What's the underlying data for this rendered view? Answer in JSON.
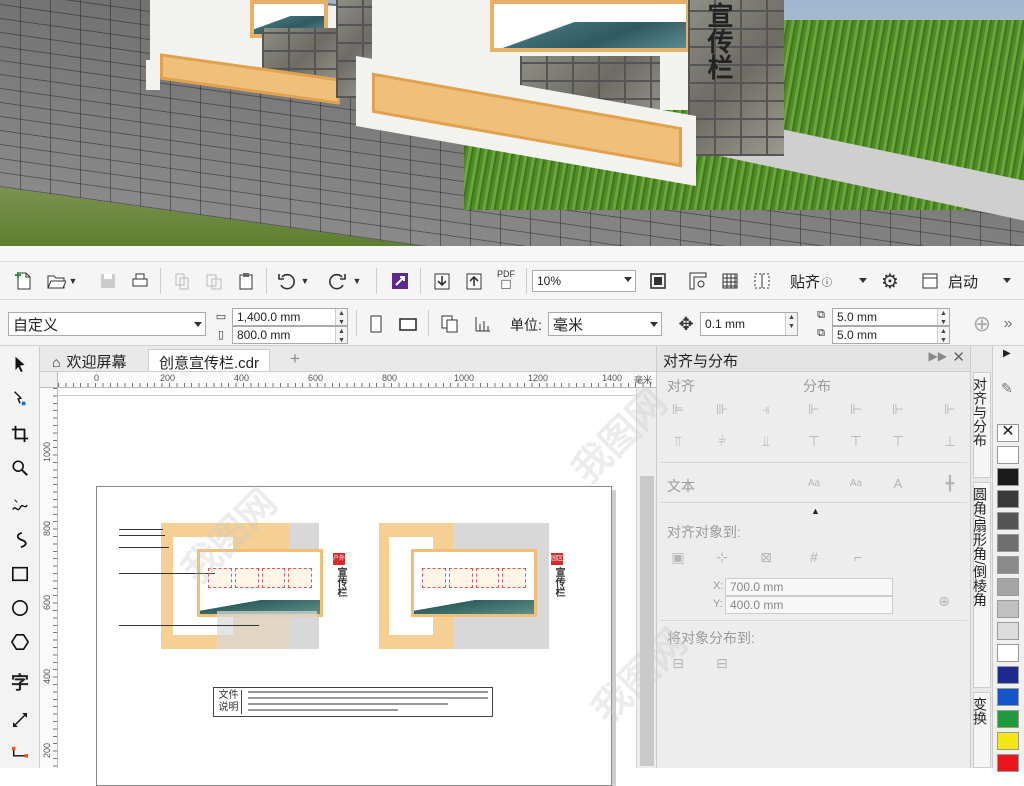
{
  "scene": {
    "board_text": "宣传栏"
  },
  "toolbar1": {
    "zoom_value": "10%",
    "snap_label": "贴齐",
    "launch_label": "启动",
    "pdf_label": "PDF"
  },
  "toolbar2": {
    "preset_value": "自定义",
    "width_value": "1,400.0 mm",
    "height_value": "800.0 mm",
    "unit_label": "单位:",
    "unit_value": "毫米",
    "nudge_value": "0.1 mm",
    "dup_x_value": "5.0 mm",
    "dup_y_value": "5.0 mm"
  },
  "tabs": [
    {
      "label": "欢迎屏幕"
    },
    {
      "label": "创意宣传栏.cdr"
    }
  ],
  "ruler": {
    "h_ticks": [
      "0",
      "200",
      "400",
      "600",
      "800",
      "1000",
      "1200",
      "1400"
    ],
    "h_unit": "毫米",
    "v_ticks": [
      "1000",
      "800",
      "600",
      "400",
      "200"
    ]
  },
  "canvas": {
    "tag1": "户外",
    "tag2": "园区",
    "board_calli": "宣传栏",
    "note_label": "文件说明"
  },
  "docker": {
    "title": "对齐与分布",
    "sec_align": "对齐",
    "sec_distribute": "分布",
    "sec_text": "文本",
    "sec_align_to": "对齐对象到:",
    "x_label": "X:",
    "x_value": "700.0 mm",
    "y_label": "Y:",
    "y_value": "400.0 mm",
    "sec_distribute_to": "将对象分布到:"
  },
  "vtabs": [
    {
      "label": "对齐与分布"
    },
    {
      "label": "圆角/扇形角/倒棱角"
    },
    {
      "label": "变换"
    }
  ],
  "palette": [
    "#ffffff",
    "#1a1a1a",
    "#3a3a3a",
    "#555555",
    "#6f6f6f",
    "#8a8a8a",
    "#a5a5a5",
    "#c0c0c0",
    "#dcdcdc",
    "#ffffff",
    "#1c2c8c",
    "#1456c8",
    "#1f9a3c",
    "#f5e614",
    "#e8171b"
  ],
  "watermark": "我图网"
}
